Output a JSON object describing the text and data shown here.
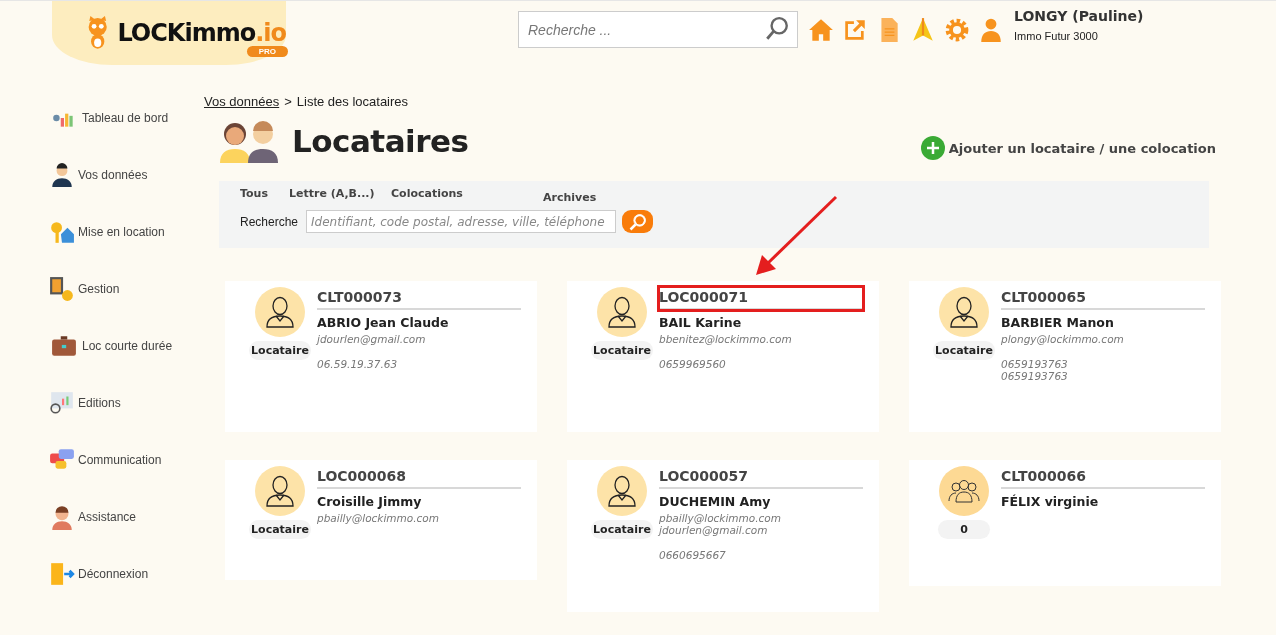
{
  "header": {
    "logo_text": "LOCKimmo",
    "logo_suffix": ".io",
    "logo_badge": "PRO",
    "search": {
      "placeholder": "Recherche ..."
    },
    "user": {
      "name": "LONGY (Pauline)",
      "company": "Immo Futur 3000"
    }
  },
  "sidebar": {
    "items": [
      {
        "label": "Tableau de bord"
      },
      {
        "label": "Vos données"
      },
      {
        "label": "Mise en location"
      },
      {
        "label": "Gestion"
      },
      {
        "label": "Loc courte durée"
      },
      {
        "label": "Editions"
      },
      {
        "label": "Communication"
      },
      {
        "label": "Assistance"
      },
      {
        "label": "Déconnexion"
      }
    ]
  },
  "breadcrumb": {
    "link": "Vos données",
    "separator": ">",
    "current": "Liste des locataires"
  },
  "page": {
    "title": "Locataires",
    "add_button": "Ajouter un locataire / une colocation"
  },
  "filters": {
    "tabs": [
      "Tous",
      "Lettre (A,B...)",
      "Colocations",
      "Archives"
    ],
    "search_label": "Recherche",
    "search_placeholder": "Identifiant, code postal, adresse, ville, téléphone"
  },
  "cards": [
    {
      "kind": "person",
      "id": "CLT000073",
      "name": "ABRIO Jean Claude",
      "badge": "Locataire",
      "emails": [
        "jdourlen@gmail.com"
      ],
      "phones": [
        "06.59.19.37.63"
      ],
      "highlighted": false
    },
    {
      "kind": "person",
      "id": "LOC000071",
      "name": "BAIL Karine",
      "badge": "Locataire",
      "emails": [
        "bbenitez@lockimmo.com"
      ],
      "phones": [
        "0659969560"
      ],
      "highlighted": true
    },
    {
      "kind": "person",
      "id": "CLT000065",
      "name": "BARBIER Manon",
      "badge": "Locataire",
      "emails": [
        "plongy@lockimmo.com"
      ],
      "phones": [
        "0659193763",
        "0659193763"
      ],
      "highlighted": false
    },
    {
      "kind": "person",
      "id": "LOC000068",
      "name": "Croisille Jimmy",
      "badge": "Locataire",
      "emails": [
        "pbailly@lockimmo.com"
      ],
      "highlighted": false
    },
    {
      "kind": "person",
      "id": "LOC000057",
      "name": "DUCHEMIN Amy",
      "badge": "Locataire",
      "emails": [
        "pbailly@lockimmo.com",
        "jdourlen@gmail.com"
      ],
      "phones": [
        "0660695667"
      ],
      "highlighted": false
    },
    {
      "kind": "group",
      "id": "CLT000066",
      "name": "FÉLIX virginie",
      "badge": "0",
      "highlighted": false
    }
  ]
}
